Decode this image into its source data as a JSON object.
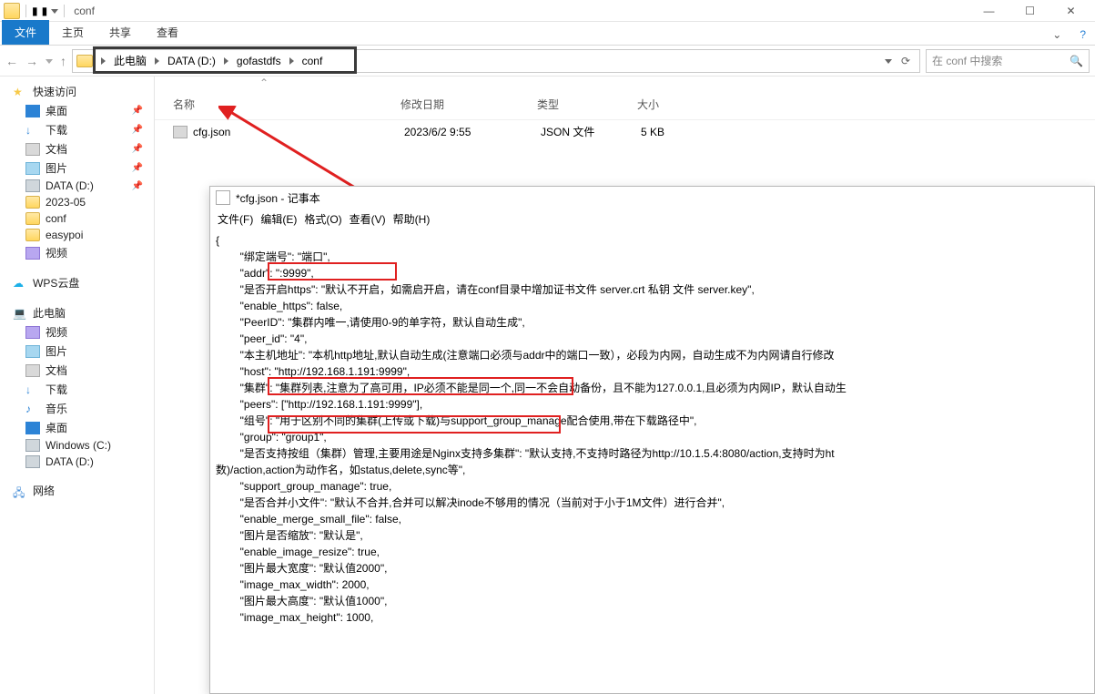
{
  "titlebar": {
    "title": "conf"
  },
  "ribbon": {
    "file": "文件",
    "home": "主页",
    "share": "共享",
    "view": "查看"
  },
  "breadcrumbs": [
    "此电脑",
    "DATA (D:)",
    "gofastdfs",
    "conf"
  ],
  "search": {
    "placeholder": "在 conf 中搜索"
  },
  "columns": {
    "name": "名称",
    "date": "修改日期",
    "type": "类型",
    "size": "大小"
  },
  "files": [
    {
      "name": "cfg.json",
      "date": "2023/6/2 9:55",
      "type": "JSON 文件",
      "size": "5 KB"
    }
  ],
  "sidebar": {
    "quick": "快速访问",
    "quick_items": [
      {
        "label": "桌面",
        "pin": true,
        "ic": "desk"
      },
      {
        "label": "下载",
        "pin": true,
        "ic": "down"
      },
      {
        "label": "文档",
        "pin": true,
        "ic": "doc"
      },
      {
        "label": "图片",
        "pin": true,
        "ic": "pic"
      },
      {
        "label": "DATA (D:)",
        "pin": true,
        "ic": "drive"
      },
      {
        "label": "2023-05",
        "pin": false,
        "ic": "fold"
      },
      {
        "label": "conf",
        "pin": false,
        "ic": "fold"
      },
      {
        "label": "easypoi",
        "pin": false,
        "ic": "fold"
      },
      {
        "label": "视频",
        "pin": false,
        "ic": "vid"
      }
    ],
    "wps": "WPS云盘",
    "pc": "此电脑",
    "pc_items": [
      {
        "label": "视频",
        "ic": "vid"
      },
      {
        "label": "图片",
        "ic": "pic"
      },
      {
        "label": "文档",
        "ic": "doc"
      },
      {
        "label": "下载",
        "ic": "down"
      },
      {
        "label": "音乐",
        "ic": "mus"
      },
      {
        "label": "桌面",
        "ic": "desk"
      },
      {
        "label": "Windows (C:)",
        "ic": "drive"
      },
      {
        "label": "DATA (D:)",
        "ic": "drive"
      }
    ],
    "net": "网络"
  },
  "notepad": {
    "title": "*cfg.json - 记事本",
    "menu": {
      "file": "文件(F)",
      "edit": "编辑(E)",
      "format": "格式(O)",
      "view": "查看(V)",
      "help": "帮助(H)"
    },
    "lines": [
      "{",
      "        \"绑定端号\": \"端口\",",
      "        \"addr\": \":9999\",",
      "        \"是否开启https\": \"默认不开启，如需启开启，请在conf目录中增加证书文件 server.crt 私钥 文件 server.key\",",
      "        \"enable_https\": false,",
      "        \"PeerID\": \"集群内唯一,请使用0-9的单字符，默认自动生成\",",
      "        \"peer_id\": \"4\",",
      "        \"本主机地址\": \"本机http地址,默认自动生成(注意端口必须与addr中的端口一致），必段为内网，自动生成不为内网请自行修改",
      "        \"host\": \"http://192.168.1.191:9999\",",
      "        \"集群\": \"集群列表,注意为了高可用，IP必须不能是同一个,同一不会自动备份，且不能为127.0.0.1,且必须为内网IP，默认自动生",
      "        \"peers\": [\"http://192.168.1.191:9999\"],",
      "        \"组号\": \"用于区别不同的集群(上传或下载)与support_group_manage配合使用,带在下载路径中\",",
      "        \"group\": \"group1\",",
      "        \"是否支持按组（集群）管理,主要用途是Nginx支持多集群\": \"默认支持,不支持时路径为http://10.1.5.4:8080/action,支持时为ht",
      "数)/action,action为动作名，如status,delete,sync等\",",
      "        \"support_group_manage\": true,",
      "        \"是否合并小文件\": \"默认不合并,合并可以解决inode不够用的情况（当前对于小于1M文件）进行合并\",",
      "        \"enable_merge_small_file\": false,",
      "        \"图片是否缩放\": \"默认是\",",
      "        \"enable_image_resize\": true,",
      "        \"图片最大宽度\": \"默认值2000\",",
      "        \"image_max_width\": 2000,",
      "        \"图片最大高度\": \"默认值1000\",",
      "        \"image_max_height\": 1000,"
    ]
  }
}
